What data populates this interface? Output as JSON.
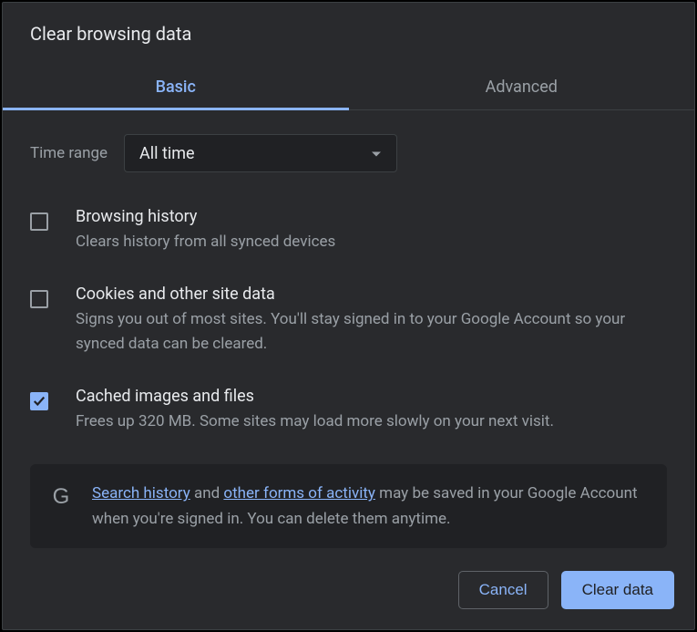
{
  "dialog": {
    "title": "Clear browsing data"
  },
  "tabs": {
    "basic": "Basic",
    "advanced": "Advanced"
  },
  "timeRange": {
    "label": "Time range",
    "value": "All time"
  },
  "options": {
    "browsingHistory": {
      "title": "Browsing history",
      "desc": "Clears history from all synced devices",
      "checked": false
    },
    "cookies": {
      "title": "Cookies and other site data",
      "desc": "Signs you out of most sites. You'll stay signed in to your Google Account so your synced data can be cleared.",
      "checked": false
    },
    "cache": {
      "title": "Cached images and files",
      "desc": "Frees up 320 MB. Some sites may load more slowly on your next visit.",
      "checked": true
    }
  },
  "notice": {
    "link1": "Search history",
    "mid1": " and ",
    "link2": "other forms of activity",
    "rest": " may be saved in your Google Account when you're signed in. You can delete them anytime."
  },
  "buttons": {
    "cancel": "Cancel",
    "clear": "Clear data"
  }
}
